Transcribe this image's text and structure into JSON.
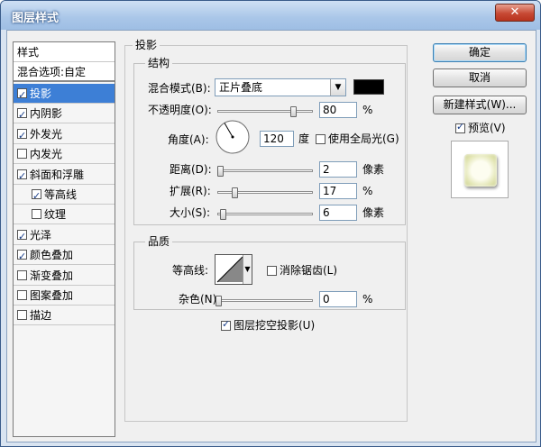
{
  "window": {
    "title": "图层样式",
    "close_icon": "close-x-icon",
    "close_glyph": "✕"
  },
  "style_list": {
    "header": "样式",
    "blending_options": "混合选项:自定",
    "items": [
      {
        "label": "投影",
        "checked": true,
        "selected": true,
        "indent": 0
      },
      {
        "label": "内阴影",
        "checked": true,
        "selected": false,
        "indent": 0
      },
      {
        "label": "外发光",
        "checked": true,
        "selected": false,
        "indent": 0
      },
      {
        "label": "内发光",
        "checked": false,
        "selected": false,
        "indent": 0
      },
      {
        "label": "斜面和浮雕",
        "checked": true,
        "selected": false,
        "indent": 0
      },
      {
        "label": "等高线",
        "checked": true,
        "selected": false,
        "indent": 1
      },
      {
        "label": "纹理",
        "checked": false,
        "selected": false,
        "indent": 1
      },
      {
        "label": "光泽",
        "checked": true,
        "selected": false,
        "indent": 0
      },
      {
        "label": "颜色叠加",
        "checked": true,
        "selected": false,
        "indent": 0
      },
      {
        "label": "渐变叠加",
        "checked": false,
        "selected": false,
        "indent": 0
      },
      {
        "label": "图案叠加",
        "checked": false,
        "selected": false,
        "indent": 0
      },
      {
        "label": "描边",
        "checked": false,
        "selected": false,
        "indent": 0
      }
    ]
  },
  "drop_shadow": {
    "title": "投影",
    "structure": {
      "title": "结构",
      "blend_mode_label": "混合模式(B):",
      "blend_mode_value": "正片叠底",
      "shadow_color": "#000000",
      "opacity_label": "不透明度(O):",
      "opacity_value": "80",
      "opacity_fraction": 0.8,
      "opacity_unit": "%",
      "angle_label": "角度(A):",
      "angle_value": "120",
      "angle_unit": "度",
      "global_light_label": "使用全局光(G)",
      "global_light_checked": false,
      "distance_label": "距离(D):",
      "distance_value": "2",
      "distance_fraction": 0.02,
      "distance_unit": "像素",
      "spread_label": "扩展(R):",
      "spread_value": "17",
      "spread_fraction": 0.17,
      "spread_unit": "%",
      "size_label": "大小(S):",
      "size_value": "6",
      "size_fraction": 0.05,
      "size_unit": "像素"
    },
    "quality": {
      "title": "品质",
      "contour_label": "等高线:",
      "anti_alias_label": "消除锯齿(L)",
      "anti_alias_checked": false,
      "noise_label": "杂色(N):",
      "noise_value": "0",
      "noise_fraction": 0.0,
      "noise_unit": "%"
    },
    "knockout_label": "图层挖空投影(U)",
    "knockout_checked": true
  },
  "buttons": {
    "ok": "确定",
    "cancel": "取消",
    "new_style": "新建样式(W)...",
    "preview_label": "预览(V)",
    "preview_checked": true
  }
}
